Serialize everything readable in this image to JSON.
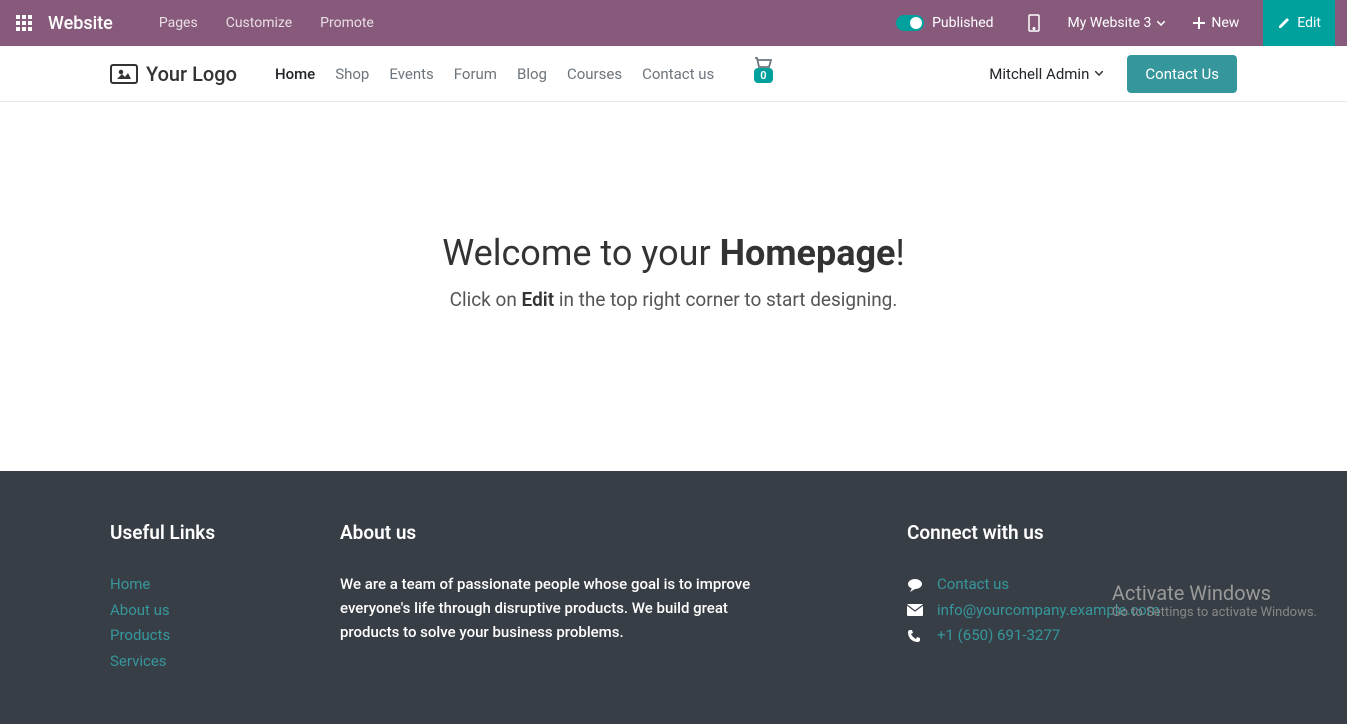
{
  "topbar": {
    "brand": "Website",
    "menu": [
      "Pages",
      "Customize",
      "Promote"
    ],
    "published_label": "Published",
    "website_selector": "My Website 3",
    "new_label": "New",
    "edit_label": "Edit"
  },
  "navbar": {
    "logo_text": "Your Logo",
    "links": [
      "Home",
      "Shop",
      "Events",
      "Forum",
      "Blog",
      "Courses",
      "Contact us"
    ],
    "active_index": 0,
    "cart_count": "0",
    "user_name": "Mitchell Admin",
    "contact_btn": "Contact Us"
  },
  "hero": {
    "title_pre": "Welcome to your ",
    "title_bold": "Homepage",
    "title_post": "!",
    "sub_pre": "Click on ",
    "sub_bold": "Edit",
    "sub_post": " in the top right corner to start designing."
  },
  "footer": {
    "links_title": "Useful Links",
    "links": [
      "Home",
      "About us",
      "Products",
      "Services"
    ],
    "about_title": "About us",
    "about_text": "We are a team of passionate people whose goal is to improve everyone's life through disruptive products. We build great products to solve your business problems.",
    "connect_title": "Connect with us",
    "connect": {
      "contact": "Contact us",
      "email": "info@yourcompany.example.com",
      "phone": "+1 (650) 691-3277"
    }
  },
  "watermark": {
    "line1": "Activate Windows",
    "line2": "Go to Settings to activate Windows."
  }
}
